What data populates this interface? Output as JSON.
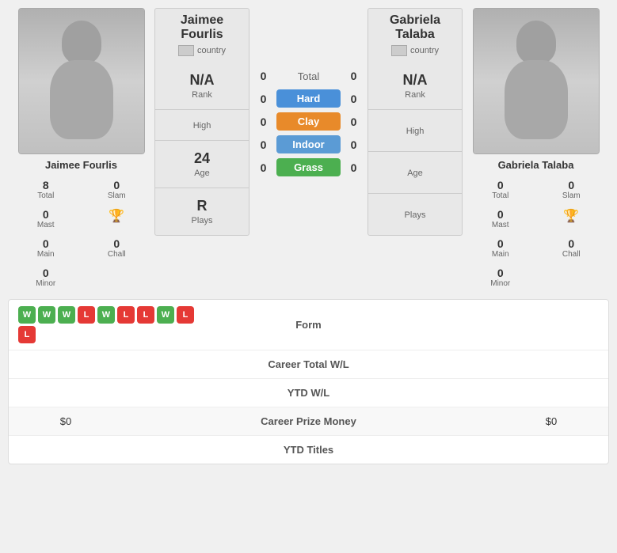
{
  "players": {
    "left": {
      "name": "Jaimee Fourlis",
      "name_line1": "Jaimee",
      "name_line2": "Fourlis",
      "country_text": "country",
      "rank_label": "Rank",
      "rank_value": "N/A",
      "high_label": "High",
      "age_label": "Age",
      "age_value": "24",
      "plays_label": "Plays",
      "plays_value": "R",
      "stats": {
        "total": "8",
        "total_label": "Total",
        "slam": "0",
        "slam_label": "Slam",
        "mast": "0",
        "mast_label": "Mast",
        "main": "0",
        "main_label": "Main",
        "chall": "0",
        "chall_label": "Chall",
        "minor": "0",
        "minor_label": "Minor"
      }
    },
    "right": {
      "name": "Gabriela Talaba",
      "name_line1": "Gabriela",
      "name_line2": "Talaba",
      "country_text": "country",
      "rank_label": "Rank",
      "rank_value": "N/A",
      "high_label": "High",
      "age_label": "Age",
      "age_value": "",
      "plays_label": "Plays",
      "plays_value": "",
      "stats": {
        "total": "0",
        "total_label": "Total",
        "slam": "0",
        "slam_label": "Slam",
        "mast": "0",
        "mast_label": "Mast",
        "main": "0",
        "main_label": "Main",
        "chall": "0",
        "chall_label": "Chall",
        "minor": "0",
        "minor_label": "Minor"
      }
    }
  },
  "center": {
    "total_label": "Total",
    "total_left": "0",
    "total_right": "0",
    "surfaces": [
      {
        "name": "Hard",
        "class": "surface-hard",
        "left": "0",
        "right": "0"
      },
      {
        "name": "Clay",
        "class": "surface-clay",
        "left": "0",
        "right": "0"
      },
      {
        "name": "Indoor",
        "class": "surface-indoor",
        "left": "0",
        "right": "0"
      },
      {
        "name": "Grass",
        "class": "surface-grass",
        "left": "0",
        "right": "0"
      }
    ]
  },
  "form": {
    "label": "Form",
    "badges": [
      "W",
      "W",
      "W",
      "L",
      "W",
      "L",
      "L",
      "W",
      "L",
      "L"
    ]
  },
  "bottom_rows": [
    {
      "label": "Career Total W/L",
      "left": "",
      "right": ""
    },
    {
      "label": "YTD W/L",
      "left": "",
      "right": ""
    },
    {
      "label": "Career Prize Money",
      "left": "$0",
      "right": "$0"
    },
    {
      "label": "YTD Titles",
      "left": "",
      "right": ""
    }
  ]
}
